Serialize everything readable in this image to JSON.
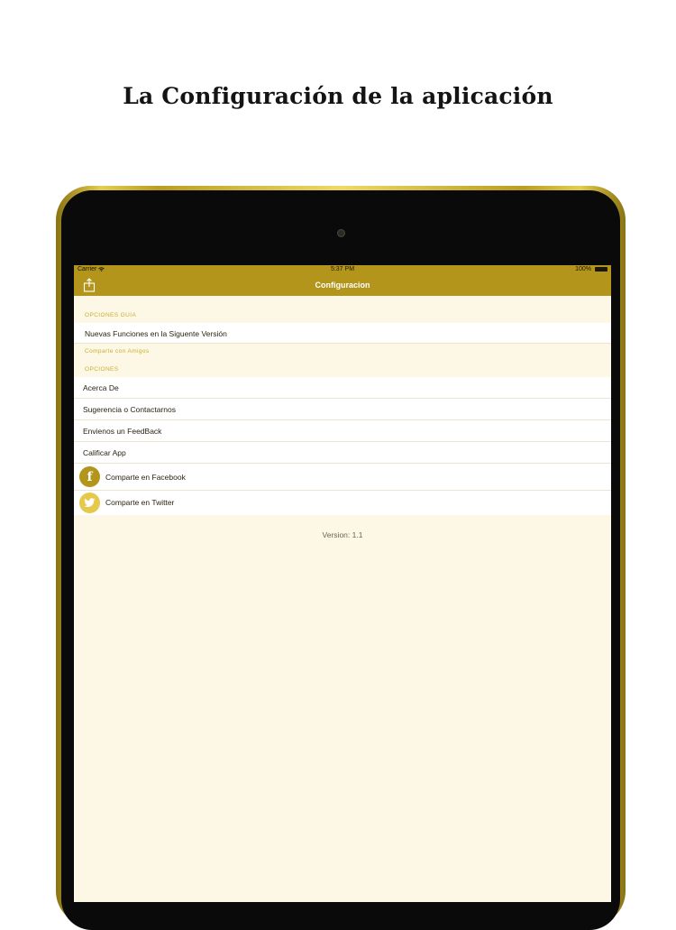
{
  "headline": "La Configuración de la aplicación",
  "status_bar": {
    "carrier": "Carrier",
    "time": "5:37 PM",
    "battery": "100%"
  },
  "nav": {
    "title": "Configuracion",
    "share_icon": "share-icon"
  },
  "sections": [
    {
      "header": "OPCIONES GUIA",
      "items": [
        {
          "label": "Nuevas Funciones en la Siguente Versión"
        }
      ]
    },
    {
      "header": "Comparte con Amigos",
      "items": []
    },
    {
      "header": "OPCIONES",
      "items": [
        {
          "label": "Acerca De"
        },
        {
          "label": "Sugerencia o Contactarnos"
        },
        {
          "label": "Envienos un FeedBack"
        },
        {
          "label": "Calificar App"
        },
        {
          "label": "Comparte en Facebook",
          "icon": "facebook-icon"
        },
        {
          "label": "Comparte en Twitter",
          "icon": "twitter-icon"
        }
      ]
    }
  ],
  "version": "Version: 1.1",
  "colors": {
    "accent": "#b3951c",
    "twitter_accent": "#e6c84a",
    "background": "#fdf8e6",
    "section_header": "#c9ae2f"
  }
}
